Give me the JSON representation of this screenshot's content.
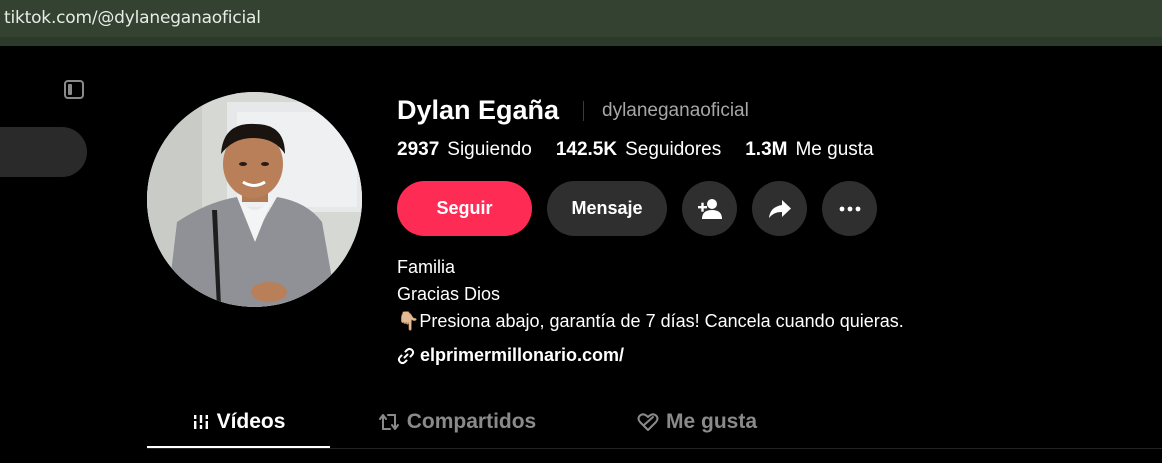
{
  "browser": {
    "url": "tiktok.com/@dylaneganaoficial"
  },
  "profile": {
    "name": "Dylan Egaña",
    "handle": "dylaneganaoficial",
    "stats": [
      {
        "value": "2937",
        "label": "Siguiendo"
      },
      {
        "value": "142.5K",
        "label": "Seguidores"
      },
      {
        "value": "1.3M",
        "label": "Me gusta"
      }
    ],
    "actions": {
      "follow_label": "Seguir",
      "message_label": "Mensaje",
      "icons": [
        "add-friend-icon",
        "share-icon",
        "more-icon"
      ]
    },
    "bio": {
      "lines": [
        "Familia",
        "Gracias Dios",
        "👇🏼Presiona abajo, garantía de 7 días! Cancela cuando quieras."
      ],
      "link": "elprimermillonario.com/"
    }
  },
  "tabs": [
    {
      "label": "Vídeos",
      "icon": "videos-grid-icon",
      "active": true
    },
    {
      "label": "Compartidos",
      "icon": "repost-icon",
      "active": false
    },
    {
      "label": "Me gusta",
      "icon": "heart-hidden-icon",
      "active": false
    }
  ],
  "colors": {
    "accent": "#fe2c55",
    "button_dark": "#2f2f2f",
    "url_bar": "#344232"
  }
}
